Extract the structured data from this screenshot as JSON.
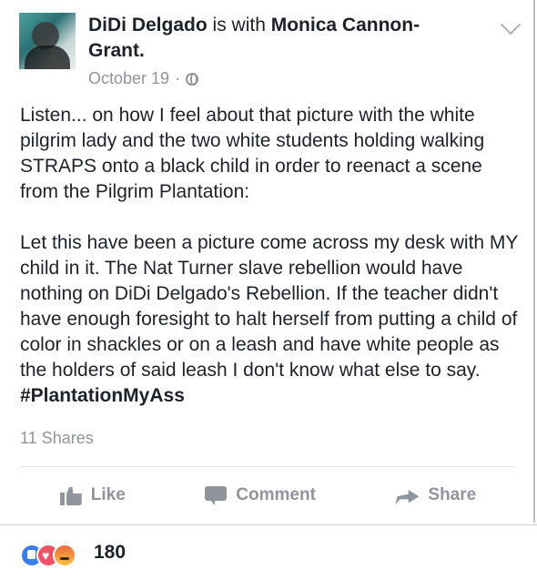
{
  "post": {
    "author": "DiDi Delgado",
    "with_text": "is with",
    "tagged_person_line1": "Monica Cannon-",
    "tagged_person_line2": "Grant.",
    "date": "October 19",
    "separator": "·",
    "privacy_icon": "globe-icon",
    "menu_icon": "chevron-down-icon",
    "paragraph1": "Listen... on how I feel about that picture with the white pilgrim lady and the two white students holding walking STRAPS onto a black child in order to reenact a scene from the Pilgrim Plantation:",
    "paragraph2": "Let this have been a picture come across my desk with MY child in it. The Nat Turner slave rebellion would have nothing on DiDi Delgado's Rebellion. If the teacher didn't have enough foresight to halt herself from putting a child of color in shackles or on a leash and have white people as the holders of said leash I don't know what else to say.",
    "hashtag": "#PlantationMyAss",
    "shares": "11 Shares"
  },
  "actions": {
    "like": "Like",
    "comment": "Comment",
    "share": "Share"
  },
  "reactions": {
    "icons": [
      "like-reaction-icon",
      "love-reaction-icon",
      "angry-reaction-icon"
    ],
    "count": "180"
  },
  "colors": {
    "text": "#1d2129",
    "muted": "#90949c",
    "like_blue": "#3b7de9",
    "love_red": "#f25268"
  }
}
